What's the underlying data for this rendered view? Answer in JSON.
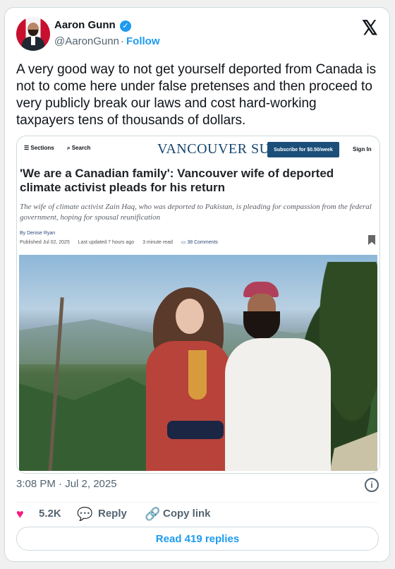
{
  "author": {
    "name": "Aaron Gunn",
    "handle": "@AaronGunn",
    "separator": "·",
    "follow_label": "Follow",
    "verified": "✓"
  },
  "tweet": {
    "text": "A very good way to not get yourself deported from Canada is not to come here under false pretenses and then proceed to very publicly break our laws and cost hard-working taxpayers tens of thousands of dollars."
  },
  "article": {
    "sections_label": "Sections",
    "search_label": "Search",
    "brand": "VANCOUVER SUN",
    "subscribe_label": "Subscribe for $0.50/week",
    "signin_label": "Sign In",
    "headline": "'We are a Canadian family': Vancouver wife of deported climate activist pleads for his return",
    "dek": "The wife of climate activist Zain Haq, who was deported to Pakistan, is pleading for compassion from the federal government, hoping for spousal reunification",
    "byline": "By Denise Ryan",
    "published": "Published Jul 02, 2025",
    "updated": "Last updated 7 hours ago",
    "read_time": "3 minute read",
    "comments": "38 Comments"
  },
  "tweet_meta": {
    "timestamp": "3:08 PM · Jul 2, 2025",
    "info_icon": "i"
  },
  "actions": {
    "like_count": "5.2K",
    "reply_label": "Reply",
    "copy_label": "Copy link",
    "read_replies": "Read 419 replies"
  },
  "icons": [
    "x-logo-icon",
    "verified-badge-icon",
    "hamburger-icon",
    "search-icon",
    "bookmark-icon",
    "comment-icon",
    "heart-icon",
    "reply-icon",
    "link-icon",
    "info-icon"
  ],
  "colors": {
    "accent": "#1d9bf0",
    "like": "#f91880",
    "brand": "#17456f",
    "subscribe": "#1b4f7a"
  }
}
